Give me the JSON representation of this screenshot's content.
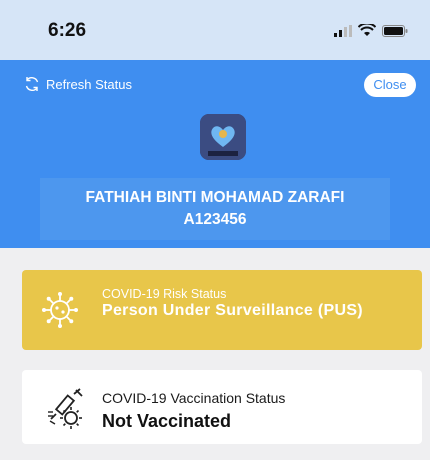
{
  "status_bar": {
    "time": "6:26"
  },
  "header": {
    "refresh_label": "Refresh Status",
    "close_label": "Close",
    "user_name": "FATHIAH BINTI MOHAMAD ZARAFI",
    "user_id": "A123456"
  },
  "risk": {
    "label": "COVID-19 Risk Status",
    "value": "Person Under Surveillance (PUS)",
    "icon": "virus-icon"
  },
  "vaccination": {
    "label": "COVID-19 Vaccination Status",
    "value": "Not Vaccinated",
    "icon": "syringe-virus-icon"
  },
  "colors": {
    "header_blue": "#3f8ef0",
    "risk_yellow": "#e8c64a",
    "background": "#efeff1"
  }
}
